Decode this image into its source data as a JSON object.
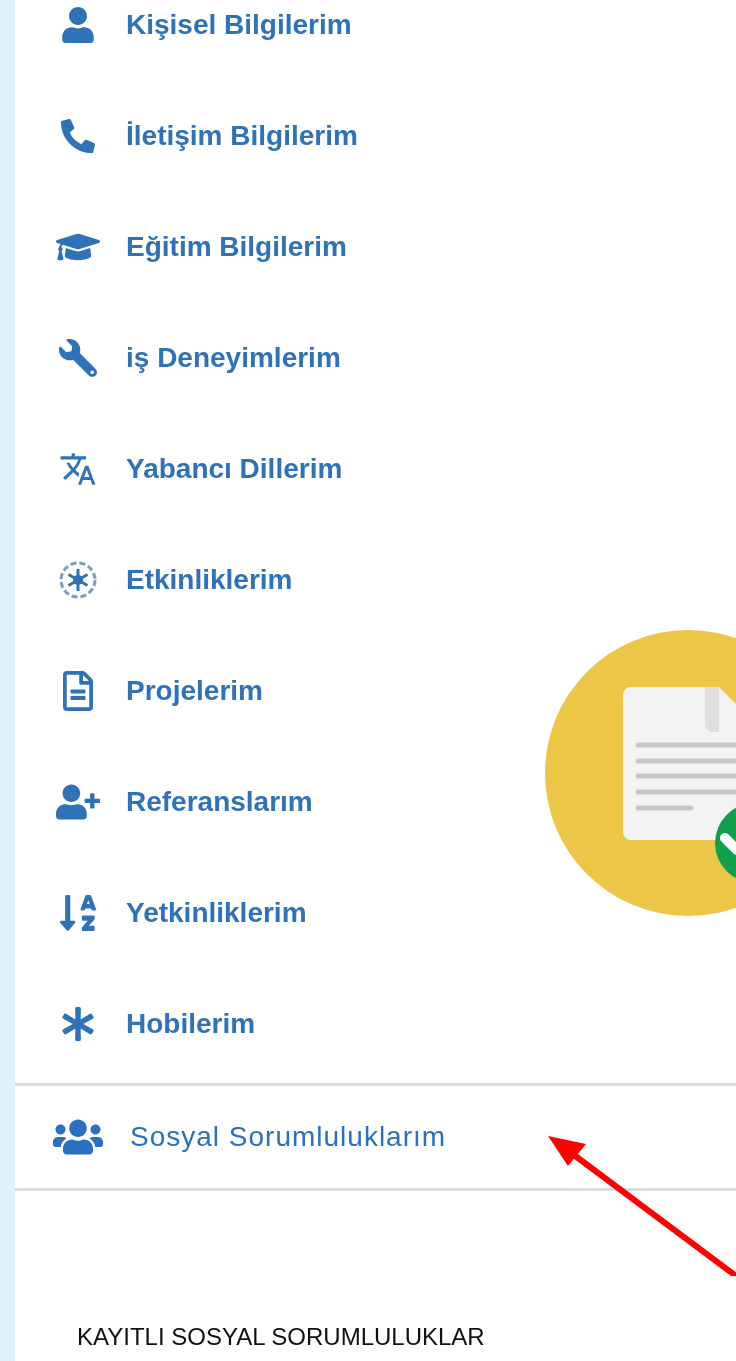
{
  "menu": [
    {
      "kind": "user",
      "label": "Kişisel Bilgilerim",
      "selected": false
    },
    {
      "kind": "phone",
      "label": "İletişim Bilgilerim",
      "selected": false
    },
    {
      "kind": "graduation",
      "label": "Eğitim Bilgilerim",
      "selected": false
    },
    {
      "kind": "wrench",
      "label": "iş Deneyimlerim",
      "selected": false
    },
    {
      "kind": "language",
      "label": "Yabancı Dillerim",
      "selected": false
    },
    {
      "kind": "activity",
      "label": "Etkinliklerim",
      "selected": false
    },
    {
      "kind": "document",
      "label": "Projelerim",
      "selected": false
    },
    {
      "kind": "userplus",
      "label": "Referanslarım",
      "selected": false
    },
    {
      "kind": "sort",
      "label": "Yetkinliklerim",
      "selected": false
    },
    {
      "kind": "asterisk",
      "label": "Hobilerim",
      "selected": false
    },
    {
      "kind": "users",
      "label": "Sosyal Sorumluluklarım",
      "selected": true
    }
  ],
  "section_heading": "KAYITLI SOSYAL SORUMLULUKLAR"
}
